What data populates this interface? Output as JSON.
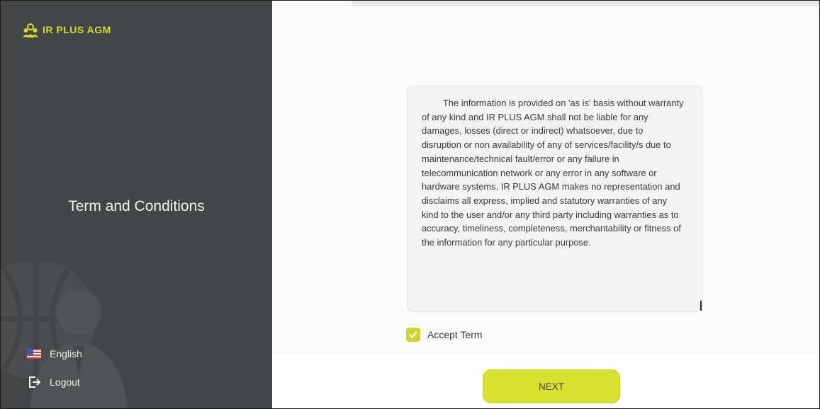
{
  "brand": {
    "name": "IR PLUS AGM",
    "accent": "#d3df2d"
  },
  "sidebar": {
    "title": "Term and Conditions",
    "language": {
      "label": "English",
      "icon": "us-flag-icon"
    },
    "logout": {
      "label": "Logout",
      "icon": "logout-icon"
    },
    "background": "#444546"
  },
  "terms": {
    "text": "The information is provided on 'as is' basis without warranty of any kind and IR PLUS AGM shall not be liable for any damages, losses (direct or indirect) whatsoever, due to disruption or non availability of any of services/facility/s due to maintenance/technical fault/error or any failure in telecommunication network or any error in any software or hardware systems. IR PLUS AGM makes no representation and disclaims all express, implied and statutory warranties of any kind to the user and/or any third party including warranties as to accuracy, timeliness, completeness, merchantability or fitness of the information for any particular purpose."
  },
  "accept": {
    "label": "Accept Term",
    "checked": true
  },
  "next_button": {
    "label": "NEXT",
    "color": "#d8e22e"
  }
}
